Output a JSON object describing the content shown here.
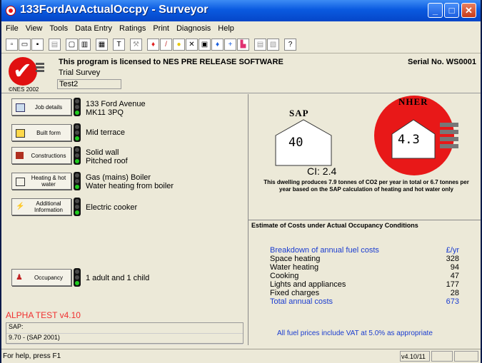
{
  "window": {
    "title": "133FordAvActualOccpy - Surveyor"
  },
  "menu": [
    "File",
    "View",
    "Tools",
    "Data Entry",
    "Ratings",
    "Print",
    "Diagnosis",
    "Help"
  ],
  "header": {
    "license": "This program is licensed to NES PRE RELEASE SOFTWARE",
    "serial": "Serial No. WS0001",
    "survey_name": "Trial Survey",
    "survey_id": "Test2",
    "copyright": "©NES 2002"
  },
  "rows": [
    {
      "button": "Job details",
      "icon": "document-icon",
      "lines": [
        "133 Ford Avenue",
        "MK11 3PQ"
      ]
    },
    {
      "button": "Built form",
      "icon": "built-form-icon",
      "lines": [
        "Mid terrace"
      ]
    },
    {
      "button": "Constructions",
      "icon": "brick-wall-icon",
      "lines": [
        "Solid wall",
        "Pitched roof"
      ]
    },
    {
      "button": "Heating & hot water",
      "icon": "radiator-icon",
      "lines": [
        "Gas (mains) Boiler",
        "Water heating from boiler"
      ]
    },
    {
      "button": "Additional Information",
      "icon": "lightning-icon",
      "lines": [
        "Electric cooker"
      ]
    },
    {
      "button": "Occupancy",
      "icon": "people-icon",
      "lines": [
        "1 adult and 1 child"
      ]
    }
  ],
  "alpha_test": "ALPHA TEST v4.10",
  "sap_version": {
    "label": "SAP:",
    "value": "9.70 - (SAP 2001)"
  },
  "ratings": {
    "sap_label": "SAP",
    "sap_value": "40",
    "nher_label": "NHER",
    "nher_value": "4.3",
    "ci": "CI: 2.4",
    "dwelling_text": "This dwelling produces 7.9 tonnes of CO2 per year in total or 6.7 tonnes per year based on the SAP calculation of heating and hot water only"
  },
  "costs": {
    "title": "Estimate of Costs under Actual Occupancy Conditions",
    "breakdown_label": "Breakdown of annual fuel costs",
    "unit": "£/yr",
    "items": [
      {
        "label": "Space heating",
        "value": "328"
      },
      {
        "label": "Water heating",
        "value": "94"
      },
      {
        "label": "Cooking",
        "value": "47"
      },
      {
        "label": "Lights and appliances",
        "value": "177"
      },
      {
        "label": "Fixed charges",
        "value": "28"
      }
    ],
    "total_label": "Total annual costs",
    "total_value": "673",
    "vat_note": "All fuel prices include VAT at 5.0% as appropriate"
  },
  "status": {
    "help": "For help, press F1",
    "version": "v4.10/11"
  },
  "colors": {
    "titlebar": "#0a5ae0",
    "rating_red": "#e81818",
    "link_blue": "#1a3cd0",
    "alpha_red": "#f03030"
  }
}
